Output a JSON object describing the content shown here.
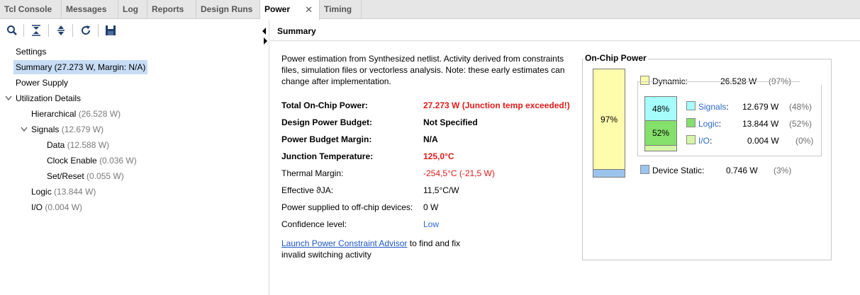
{
  "tabs": [
    {
      "label": "Tcl Console"
    },
    {
      "label": "Messages"
    },
    {
      "label": "Log"
    },
    {
      "label": "Reports"
    },
    {
      "label": "Design Runs"
    },
    {
      "label": "Power",
      "active": true
    },
    {
      "label": "Timing"
    }
  ],
  "tab_close_glyph": "✕",
  "toolbar": {
    "icons": [
      "search-icon",
      "collapse-all-icon",
      "expand-icon",
      "refresh-icon",
      "save-icon"
    ]
  },
  "tree": {
    "settings": "Settings",
    "summary": "Summary (27.273 W, Margin: N/A)",
    "power_supply": "Power Supply",
    "utilization_details": "Utilization Details",
    "hierarchical": {
      "label": "Hierarchical",
      "value": "(26.528 W)"
    },
    "signals": {
      "label": "Signals",
      "value": "(12.679 W)"
    },
    "data": {
      "label": "Data",
      "value": "(12.588 W)"
    },
    "clock_enable": {
      "label": "Clock Enable",
      "value": "(0.036 W)"
    },
    "set_reset": {
      "label": "Set/Reset",
      "value": "(0.055 W)"
    },
    "logic": {
      "label": "Logic",
      "value": "(13.844 W)"
    },
    "io": {
      "label": "I/O",
      "value": "(0.004 W)"
    }
  },
  "summary": {
    "header": "Summary",
    "description": "Power estimation from Synthesized netlist. Activity derived from constraints files, simulation files or vectorless analysis. Note: these early estimates can change after implementation.",
    "rows": {
      "total_on_chip_power": {
        "label": "Total On-Chip Power:",
        "value": "27.273 W (Junction temp exceeded!)"
      },
      "design_power_budget": {
        "label": "Design Power Budget:",
        "value": "Not Specified"
      },
      "power_budget_margin": {
        "label": "Power Budget Margin:",
        "value": "N/A"
      },
      "junction_temperature": {
        "label": "Junction Temperature:",
        "value": "125,0°C"
      },
      "thermal_margin": {
        "label": "Thermal Margin:",
        "value": "-254,5°C (-21,5 W)"
      },
      "effective_theta_ja": {
        "label": "Effective ϑJA:",
        "value": "11,5°C/W"
      },
      "power_offchip": {
        "label": "Power supplied to off-chip devices:",
        "value": "0 W"
      },
      "confidence_level": {
        "label": "Confidence level:",
        "value": "Low"
      }
    },
    "advisor_link": "Launch Power Constraint Advisor",
    "advisor_text_1": "to find and fix",
    "advisor_text_2": "invalid switching activity"
  },
  "on_chip_power": {
    "title": "On-Chip Power",
    "dynamic_pct_label": "97%",
    "dynamic": {
      "label": "Dynamic:",
      "value": "26.528 W",
      "pct": "(97%)"
    },
    "signals": {
      "label": "Signals",
      "colon": ":",
      "value": "12.679 W",
      "pct": "(48%)"
    },
    "logic": {
      "label": "Logic",
      "colon": ":",
      "value": "13.844 W",
      "pct": "(52%)"
    },
    "io": {
      "label": "I/O",
      "colon": ":",
      "value": "0.004 W",
      "pct": "(0%)"
    },
    "device_static": {
      "label": "Device Static:",
      "value": "0.746 W",
      "pct": "(3%)"
    },
    "inner_signals_pct": "48%",
    "inner_logic_pct": "52%",
    "colors": {
      "dynamic": "#fdfdab",
      "static": "#9bc4ed",
      "signals": "#a6fbfb",
      "logic": "#85e06b",
      "io": "#d5f6a9"
    }
  }
}
